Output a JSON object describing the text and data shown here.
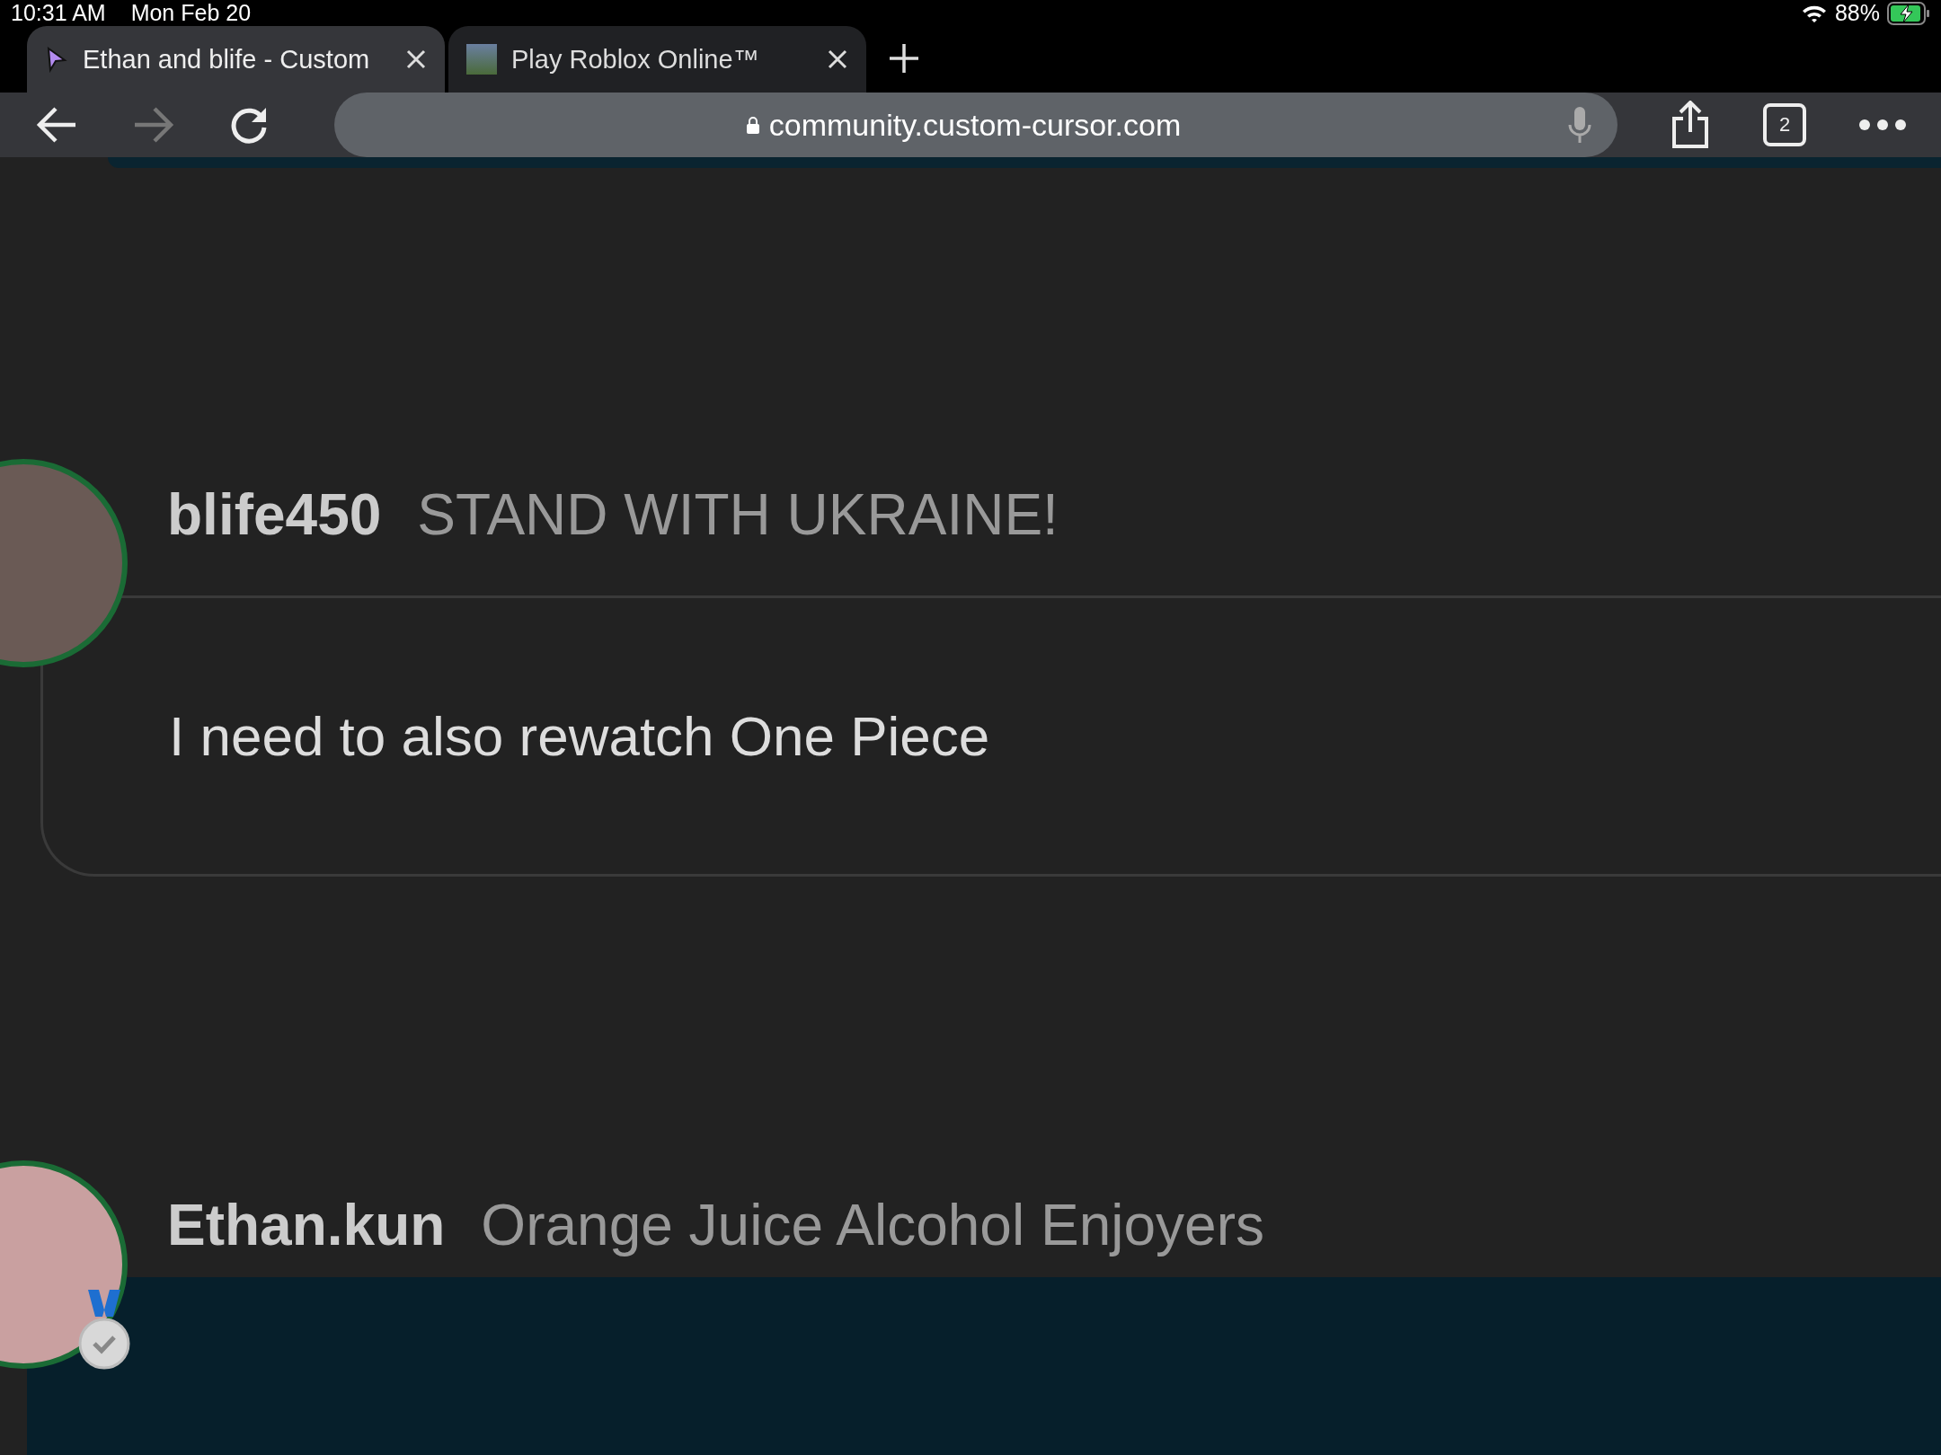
{
  "status_bar": {
    "time": "10:31 AM",
    "date": "Mon Feb 20",
    "battery": "88%"
  },
  "tabs": [
    {
      "title": "Ethan and blife - Custom",
      "selected": true
    },
    {
      "title": "Play Roblox Online™",
      "selected": false
    }
  ],
  "toolbar": {
    "back_disabled": false,
    "forward_disabled": true,
    "url": "community.custom-cursor.com",
    "tab_count": "2"
  },
  "posts": [
    {
      "username": "blife450",
      "status": "STAND WITH UKRAINE!",
      "body": "I need to also rewatch One Piece",
      "badge": false
    },
    {
      "username": "Ethan.kun",
      "status": "Orange Juice Alcohol Enjoyers",
      "badge": true
    }
  ]
}
